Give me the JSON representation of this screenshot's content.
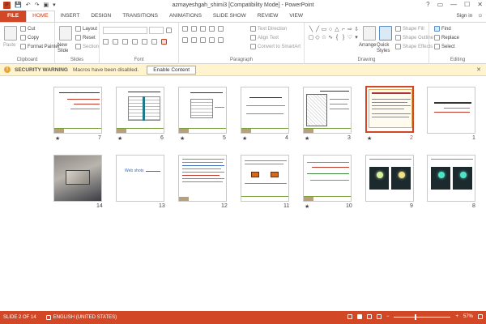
{
  "titlebar": {
    "title": "azmayeshgah_shimi3 [Compatibility Mode] - PowerPoint",
    "app_logo": "P",
    "qat": {
      "save": "💾",
      "undo": "↶",
      "redo": "↷",
      "start": "▣",
      "more": "▾"
    },
    "controls": {
      "help": "?",
      "restore": "▭",
      "minimize": "—",
      "maximize": "☐",
      "close": "✕"
    }
  },
  "tabs": [
    "FILE",
    "HOME",
    "INSERT",
    "DESIGN",
    "TRANSITIONS",
    "ANIMATIONS",
    "SLIDE SHOW",
    "REVIEW",
    "VIEW"
  ],
  "active_tab": "HOME",
  "signin": {
    "label": "Sign in",
    "smiley": "☺"
  },
  "ribbon": {
    "clipboard": {
      "paste": "Paste",
      "cut": "Cut",
      "copy": "Copy",
      "format_painter": "Format Painter",
      "label": "Clipboard"
    },
    "slides": {
      "new_slide": "New Slide",
      "layout": "Layout",
      "reset": "Reset",
      "section": "Section",
      "label": "Slides"
    },
    "font": {
      "label": "Font"
    },
    "paragraph": {
      "text_direction": "Text Direction",
      "align_text": "Align Text",
      "convert": "Convert to SmartArt",
      "label": "Paragraph"
    },
    "drawing": {
      "arrange": "Arrange",
      "quick_styles": "Quick Styles",
      "shape_fill": "Shape Fill",
      "shape_outline": "Shape Outline",
      "shape_effects": "Shape Effects",
      "label": "Drawing"
    },
    "editing": {
      "find": "Find",
      "replace": "Replace",
      "select": "Select",
      "label": "Editing"
    }
  },
  "security": {
    "title": "SECURITY WARNING",
    "message": "Macros have been disabled.",
    "button": "Enable Content",
    "close": "✕"
  },
  "slides": [
    {
      "num": "1",
      "star": ""
    },
    {
      "num": "2",
      "star": "★"
    },
    {
      "num": "3",
      "star": "★"
    },
    {
      "num": "4",
      "star": "★"
    },
    {
      "num": "5",
      "star": "★"
    },
    {
      "num": "6",
      "star": "★"
    },
    {
      "num": "7",
      "star": "★"
    },
    {
      "num": "8",
      "star": ""
    },
    {
      "num": "9",
      "star": ""
    },
    {
      "num": "10",
      "star": "★"
    },
    {
      "num": "11",
      "star": ""
    },
    {
      "num": "12",
      "star": ""
    },
    {
      "num": "13",
      "star": ""
    },
    {
      "num": "14",
      "star": ""
    }
  ],
  "slide13_link": "Web shots",
  "status": {
    "slide": "SLIDE 2 OF 14",
    "language": "ENGLISH (UNITED STATES)",
    "zoom": "57%",
    "zoom_level": 0.57,
    "minus": "−",
    "plus": "+"
  }
}
